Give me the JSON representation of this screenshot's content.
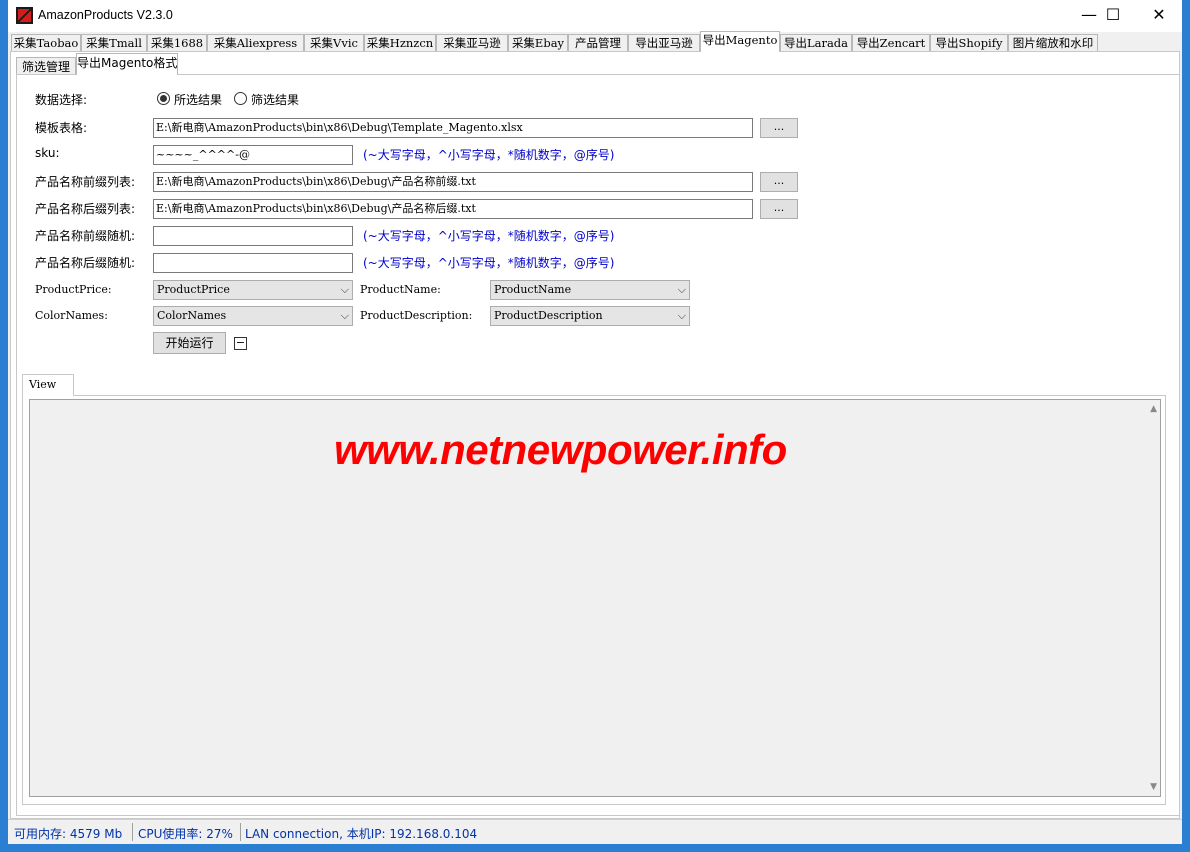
{
  "window": {
    "title": "AmazonProducts V2.3.0",
    "minimize": "—",
    "maximize": "☐",
    "close": "✕"
  },
  "main_tabs": [
    {
      "label": "采集Taobao"
    },
    {
      "label": "采集Tmall"
    },
    {
      "label": "采集1688"
    },
    {
      "label": "采集Aliexpress"
    },
    {
      "label": "采集Vvic"
    },
    {
      "label": "采集Hznzcn"
    },
    {
      "label": "采集亚马逊"
    },
    {
      "label": "采集Ebay"
    },
    {
      "label": "产品管理"
    },
    {
      "label": "导出亚马逊"
    },
    {
      "label": "导出Magento"
    },
    {
      "label": "导出Larada"
    },
    {
      "label": "导出Zencart"
    },
    {
      "label": "导出Shopify"
    },
    {
      "label": "图片缩放和水印"
    }
  ],
  "active_main_tab": "导出Magento",
  "sub_tabs": [
    {
      "label": "筛选管理"
    },
    {
      "label": "导出Magento格式"
    }
  ],
  "form": {
    "data_select_label": "数据选择:",
    "radio_selected": "所选结果",
    "radio_filtered": "筛选结果",
    "template_label": "模板表格:",
    "template_value": "E:\\新电商\\AmazonProducts\\bin\\x86\\Debug\\Template_Magento.xlsx",
    "browse": "...",
    "sku_label": "sku:",
    "sku_value": "~~~~_^^^^-@",
    "hint": "(~大写字母，^小写字母，*随机数字，@序号)",
    "prefix_list_label": "产品名称前缀列表:",
    "prefix_list_value": "E:\\新电商\\AmazonProducts\\bin\\x86\\Debug\\产品名称前缀.txt",
    "suffix_list_label": "产品名称后缀列表:",
    "suffix_list_value": "E:\\新电商\\AmazonProducts\\bin\\x86\\Debug\\产品名称后缀.txt",
    "prefix_random_label": "产品名称前缀随机:",
    "prefix_random_value": "",
    "suffix_random_label": "产品名称后缀随机:",
    "suffix_random_value": "",
    "price_label": "ProductPrice:",
    "price_value": "ProductPrice",
    "name_label": "ProductName:",
    "name_value": "ProductName",
    "color_label": "ColorNames:",
    "color_value": "ColorNames",
    "desc_label": "ProductDescription:",
    "desc_value": "ProductDescription",
    "start_button": "开始运行",
    "mini_button": "−"
  },
  "view": {
    "tab_label": "View",
    "watermark": "www.netnewpower.info"
  },
  "status": {
    "memory": "可用内存: 4579 Mb",
    "cpu": "CPU使用率: 27%",
    "network": "LAN connection, 本机IP: 192.168.0.104"
  },
  "colors": {
    "accent": "#1a6bc4",
    "hint_text": "#0000cc",
    "watermark": "#ff0000",
    "status_text": "#0033aa"
  }
}
